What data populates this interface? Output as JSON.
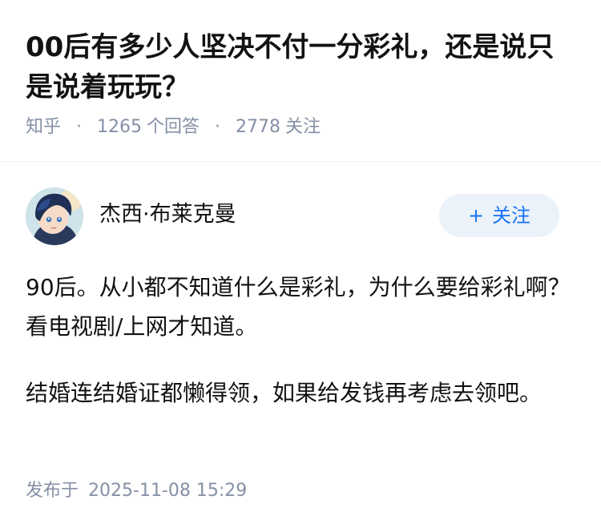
{
  "question": {
    "title": "00后有多少人坚决不付一分彩礼，还是说只是说着玩玩？",
    "source": "知乎",
    "answers_count": "1265",
    "answers_label": "个回答",
    "followers_count": "2778",
    "followers_label": "关注"
  },
  "author": {
    "name": "杰西·布莱克曼",
    "follow_icon": "+",
    "follow_label": "关注"
  },
  "answer": {
    "paragraphs": [
      "90后。从小都不知道什么是彩礼，为什么要给彩礼啊？看电视剧/上网才知道。",
      "结婚连结婚证都懒得领，如果给发钱再考虑去领吧。"
    ],
    "publish_label": "发布于",
    "publish_time": "2025-11-08 15:29"
  },
  "colors": {
    "meta_gray": "#8590a6",
    "follow_blue": "#1772f6",
    "follow_bg": "#ebf2fa"
  }
}
